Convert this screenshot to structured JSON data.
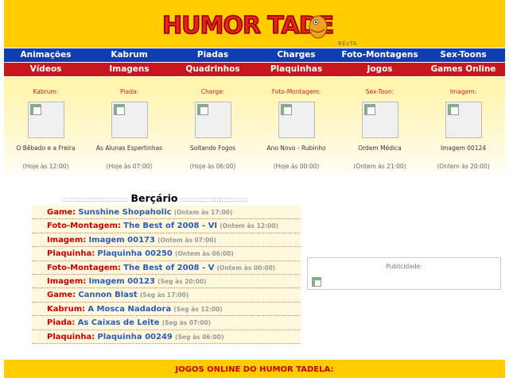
{
  "header": {
    "logo_text": "HUMOR TADELA",
    "beta": "BEsTA"
  },
  "nav_row1": [
    "Animações",
    "Kabrum",
    "Piadas",
    "Charges",
    "Foto-Montagens",
    "Sex-Toons"
  ],
  "nav_row2": [
    "Vídeos",
    "Imagens",
    "Quadrinhos",
    "Plaquinhas",
    "Jogos",
    "Games Online"
  ],
  "previews": [
    {
      "category": "Kabrum:",
      "title": "O Bêbado e a Freira",
      "time": "(Hoje às 12:00)"
    },
    {
      "category": "Piada:",
      "title": "As Alunas Espertinhas",
      "time": "(Hoje às 07:00)"
    },
    {
      "category": "Charge:",
      "title": "Soltando Fogos",
      "time": "(Hoje às 06:00)"
    },
    {
      "category": "Foto-Montagem:",
      "title": "Ano Novo - Rubinho",
      "time": "(Hoje às 00:00)"
    },
    {
      "category": "Sex-Toon:",
      "title": "Ordem Médica",
      "time": "(Ontem às 21:00)"
    },
    {
      "category": "Imagem:",
      "title": "Imagem 00124",
      "time": "(Ontem às 20:00)"
    }
  ],
  "bercario": {
    "dots": "::::::::::::::::::::::::::::",
    "title": "Berçário",
    "items": [
      {
        "category": "Game:",
        "title": "Sunshine Shopaholic",
        "time": "(Ontem às 17:00)"
      },
      {
        "category": "Foto-Montagem:",
        "title": "The Best of 2008 - VI",
        "time": "(Ontem às 12:00)"
      },
      {
        "category": "Imagem:",
        "title": "Imagem 00173",
        "time": "(Ontem às 07:00)"
      },
      {
        "category": "Plaquinha:",
        "title": "Plaquinha 00250",
        "time": "(Ontem às 06:00)"
      },
      {
        "category": "Foto-Montagem:",
        "title": "The Best of 2008 - V",
        "time": "(Ontem às 00:00)"
      },
      {
        "category": "Imagem:",
        "title": "Imagem 00123",
        "time": "(Seg às 20:00)"
      },
      {
        "category": "Game:",
        "title": "Cannon Blast",
        "time": "(Seg às 17:00)"
      },
      {
        "category": "Kabrum:",
        "title": "A Mosca Nadadora",
        "time": "(Seg às 12:00)"
      },
      {
        "category": "Piada:",
        "title": "As Caixas de Leite",
        "time": "(Seg às 07:00)"
      },
      {
        "category": "Plaquinha:",
        "title": "Plaquinha 00249",
        "time": "(Seg às 06:00)"
      }
    ]
  },
  "ad": {
    "label": "Publicidade:"
  },
  "bottom": {
    "title": "JOGOS ONLINE DO HUMOR TADELA:"
  },
  "colors": {
    "header": "#ffcc00",
    "nav_blue": "#0f3fb3",
    "nav_red": "#c8161c",
    "category_red": "#cc0000",
    "title_blue": "#2a5cb8"
  }
}
